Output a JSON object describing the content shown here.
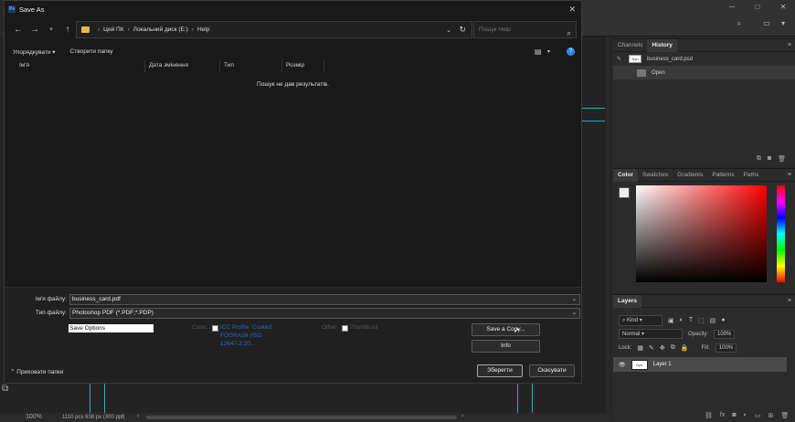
{
  "photoshop": {
    "zoom": "100%",
    "doc_info": "1110 pcx 638 px (300 ppi)",
    "history_panel": {
      "tabs": [
        "Channels",
        "History"
      ],
      "active_tab": "History",
      "snapshot_name": "business_card.psd",
      "state_name": "Open"
    },
    "color_panel": {
      "tabs": [
        "Color",
        "Swatches",
        "Gradients",
        "Patterns",
        "Paths"
      ],
      "active_tab": "Color",
      "hue_color": "#ff0000"
    },
    "layers_panel": {
      "title": "Layers",
      "filter_label": "Kind",
      "blend_mode": "Normal",
      "opacity_label": "Opacity:",
      "opacity": "100%",
      "lock_label": "Lock:",
      "fill_label": "Fill:",
      "fill": "100%",
      "layer_name": "Layer 1"
    }
  },
  "dialog": {
    "title": "Save As",
    "breadcrumb": [
      "Цей ПК",
      "Локальний диск (E:)",
      "Help"
    ],
    "search_placeholder": "Пошук Help",
    "toolbar": {
      "organize": "Упорядкувати ▾",
      "new_folder": "Створити папку"
    },
    "columns": [
      "Ім'я",
      "Дата змінення",
      "Тип",
      "Розмір"
    ],
    "empty_message": "Пошук не дав результатів.",
    "filename_label": "Ім'я файлу:",
    "filename_value": "business_card.pdf",
    "filetype_label": "Тип файлу:",
    "filetype_value": "Photoshop PDF (*.PDF;*.PDP)",
    "save_options_label": "Save Options",
    "color_label": "Color:",
    "icc_text": [
      "ICC Profile: Coated",
      "FOGRA39 (ISO",
      "12647-2:20..."
    ],
    "other_label": "Other:",
    "thumbnail_label": "Thumbnail",
    "save_copy_button": "Save a Copy...",
    "info_button": "Info",
    "save_button": "Зберегти",
    "cancel_button": "Скасувати",
    "hide_folders": "Приховати папки"
  }
}
